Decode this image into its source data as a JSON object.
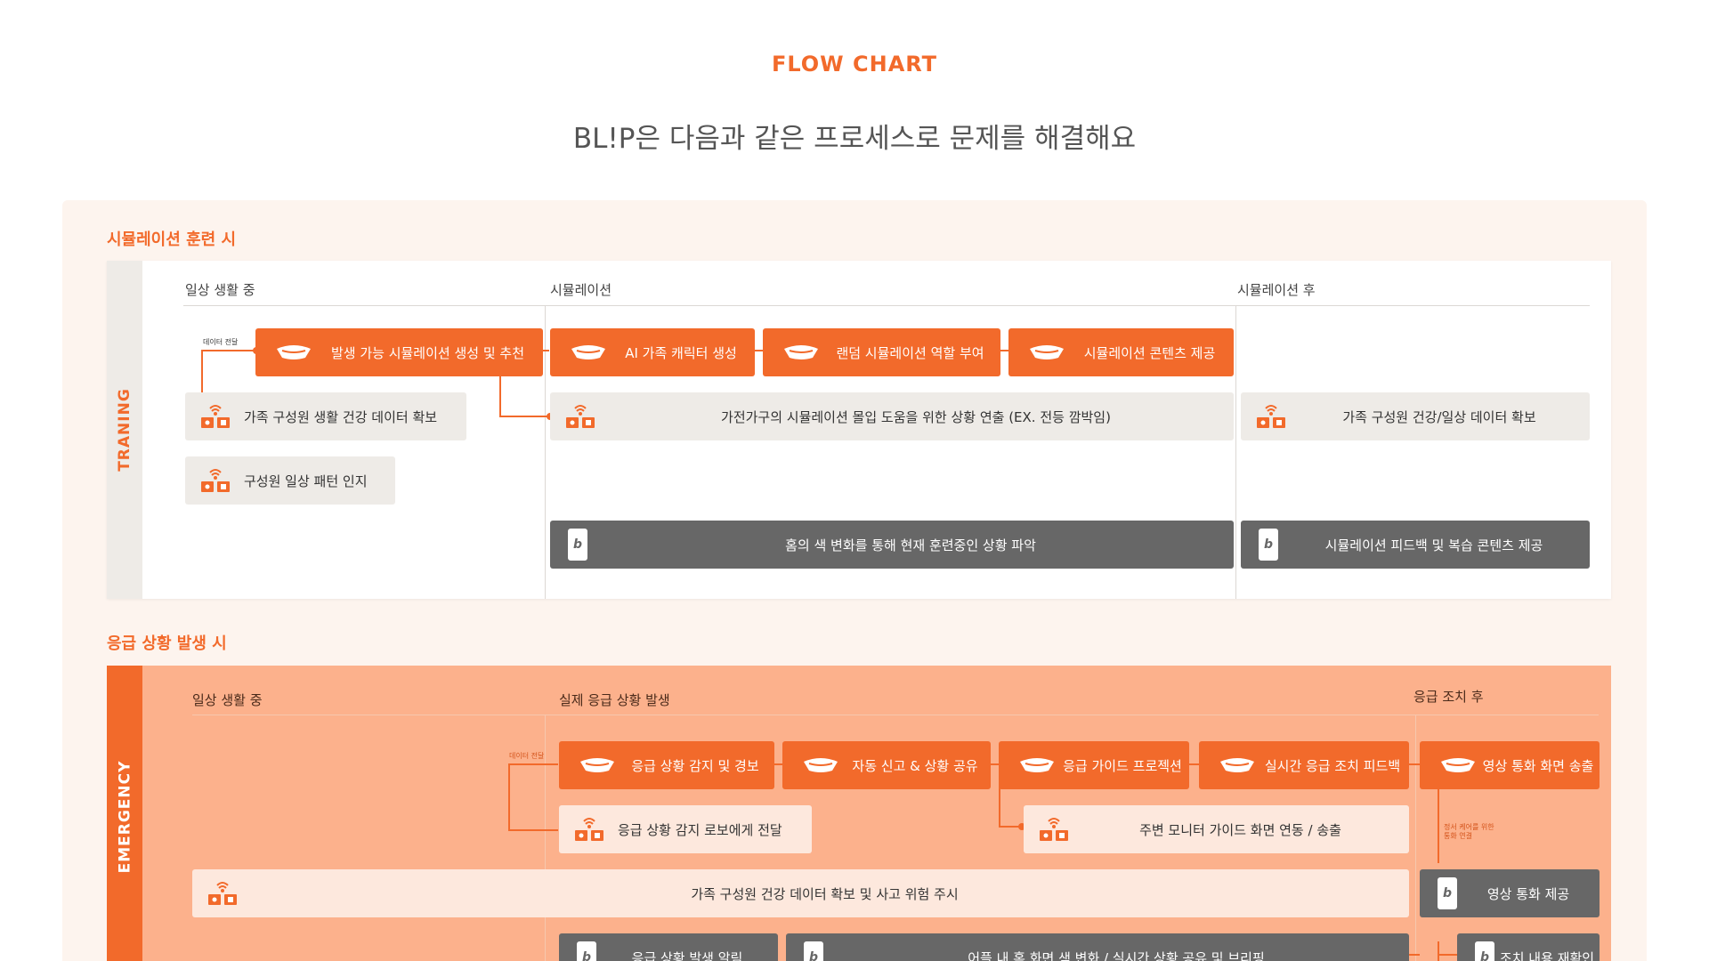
{
  "header": {
    "eyebrow": "FLOW CHART",
    "title": "BL!P은 다음과 같은 프로세스로 문제를 해결해요"
  },
  "colors": {
    "accent": "#f26a2b",
    "light_box": "#eeebe7",
    "dark_box": "#676767",
    "emergency_bg": "#fcb18c",
    "panel_bg": "#fdf4ee"
  },
  "training": {
    "section_title": "시뮬레이션 훈련 시",
    "side_label": "TRANING",
    "columns": [
      "일상 생활 중",
      "시뮬레이션",
      "시뮬레이션  후"
    ],
    "note": "데이터 전달",
    "orange": [
      {
        "label": "발생 가능 시뮬레이션 생성 및 추천",
        "icon": "robot-icon"
      },
      {
        "label": "AI 가족 캐릭터 생성",
        "icon": "robot-icon"
      },
      {
        "label": "랜덤 시뮬레이션 역할 부여",
        "icon": "robot-icon"
      },
      {
        "label": "시뮬레이션 콘텐츠 제공",
        "icon": "robot-icon"
      }
    ],
    "light": [
      {
        "label": "가족 구성원 생활 건강 데이터 확보",
        "icon": "smart-device-icon"
      },
      {
        "label": "구성원 일상 패턴 인지",
        "icon": "smart-device-icon"
      },
      {
        "label": "가전가구의 시뮬레이션 몰입 도움을 위한 상황 연출 (EX. 전등 깜박임)",
        "icon": "smart-device-icon"
      },
      {
        "label": "가족 구성원 건강/일상 데이터 확보",
        "icon": "smart-device-icon"
      }
    ],
    "dark": [
      {
        "label": "홈의 색 변화를 통해 현재 훈련중인 상황 파악",
        "icon": "phone-app-icon",
        "glyph": "b"
      },
      {
        "label": "시뮬레이션 피드백 및 복습 콘텐츠 제공",
        "icon": "phone-app-icon",
        "glyph": "b"
      }
    ]
  },
  "emergency": {
    "section_title": "응급 상황 발생 시",
    "side_label": "EMERGENCY",
    "columns": [
      "일상 생활 중",
      "실제 응급 상황 발생",
      "응급 조치 후"
    ],
    "note_left": "데이터 전달",
    "note_right_1": "정서 케어를 위한",
    "note_right_2": "통화 연결",
    "orange": [
      {
        "label": "응급 상황 감지 및 경보",
        "icon": "robot-icon"
      },
      {
        "label": "자동 신고 & 상황 공유",
        "icon": "robot-icon"
      },
      {
        "label": "응급 가이드 프로젝션",
        "icon": "robot-icon"
      },
      {
        "label": "실시간 응급 조치 피드백",
        "icon": "robot-icon"
      },
      {
        "label": "영상 통화 화면 송출",
        "icon": "robot-icon"
      }
    ],
    "light": [
      {
        "label": "응급 상황 감지 로보에게 전달",
        "icon": "smart-device-icon"
      },
      {
        "label": "주변 모니터 가이드 화면 연동 / 송출",
        "icon": "smart-device-icon"
      },
      {
        "label": "가족 구성원 건강 데이터 확보 및 사고 위험 주시",
        "icon": "smart-device-icon"
      }
    ],
    "dark": [
      {
        "label": "영상 통화 제공",
        "icon": "phone-app-icon",
        "glyph": "b"
      },
      {
        "label": "응급 상황 발생 알림",
        "icon": "phone-app-icon",
        "glyph": "b"
      },
      {
        "label": "어플 내 홈 화면 색 변화 / 실시간 상황 공유 및 브리핑",
        "icon": "phone-app-icon",
        "glyph": "b"
      },
      {
        "label": "조치 내용 재확인",
        "icon": "phone-app-icon",
        "glyph": "b"
      }
    ]
  }
}
